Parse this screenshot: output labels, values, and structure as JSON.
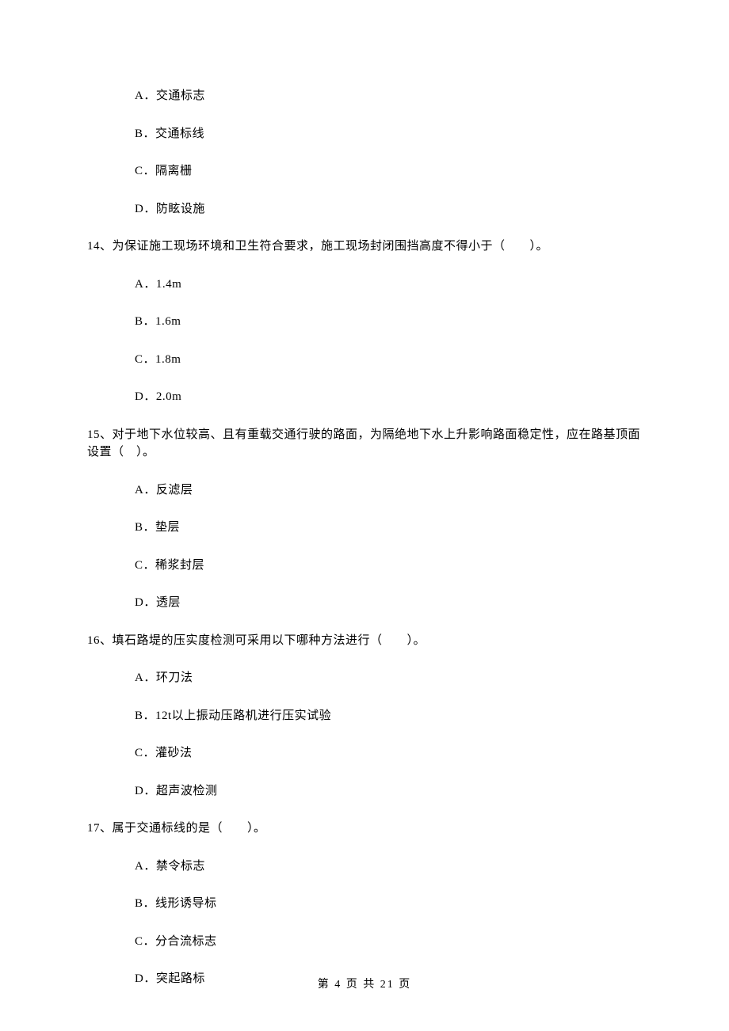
{
  "q13": {
    "options": {
      "a": "A．交通标志",
      "b": "B．交通标线",
      "c": "C．隔离栅",
      "d": "D．防眩设施"
    }
  },
  "q14": {
    "text": "14、为保证施工现场环境和卫生符合要求，施工现场封闭围挡高度不得小于（　　）。",
    "options": {
      "a": "A．1.4m",
      "b": "B．1.6m",
      "c": "C．1.8m",
      "d": "D．2.0m"
    }
  },
  "q15": {
    "text": "15、对于地下水位较高、且有重载交通行驶的路面，为隔绝地下水上升影响路面稳定性，应在路基顶面设置（　）。",
    "options": {
      "a": "A．反滤层",
      "b": "B．垫层",
      "c": "C．稀浆封层",
      "d": "D．透层"
    }
  },
  "q16": {
    "text": "16、填石路堤的压实度检测可采用以下哪种方法进行（　　）。",
    "options": {
      "a": "A．环刀法",
      "b": "B．12t以上振动压路机进行压实试验",
      "c": "C．灌砂法",
      "d": "D．超声波检测"
    }
  },
  "q17": {
    "text": "17、属于交通标线的是（　　）。",
    "options": {
      "a": "A．禁令标志",
      "b": "B．线形诱导标",
      "c": "C．分合流标志",
      "d": "D．突起路标"
    }
  },
  "footer": "第 4 页 共 21 页"
}
